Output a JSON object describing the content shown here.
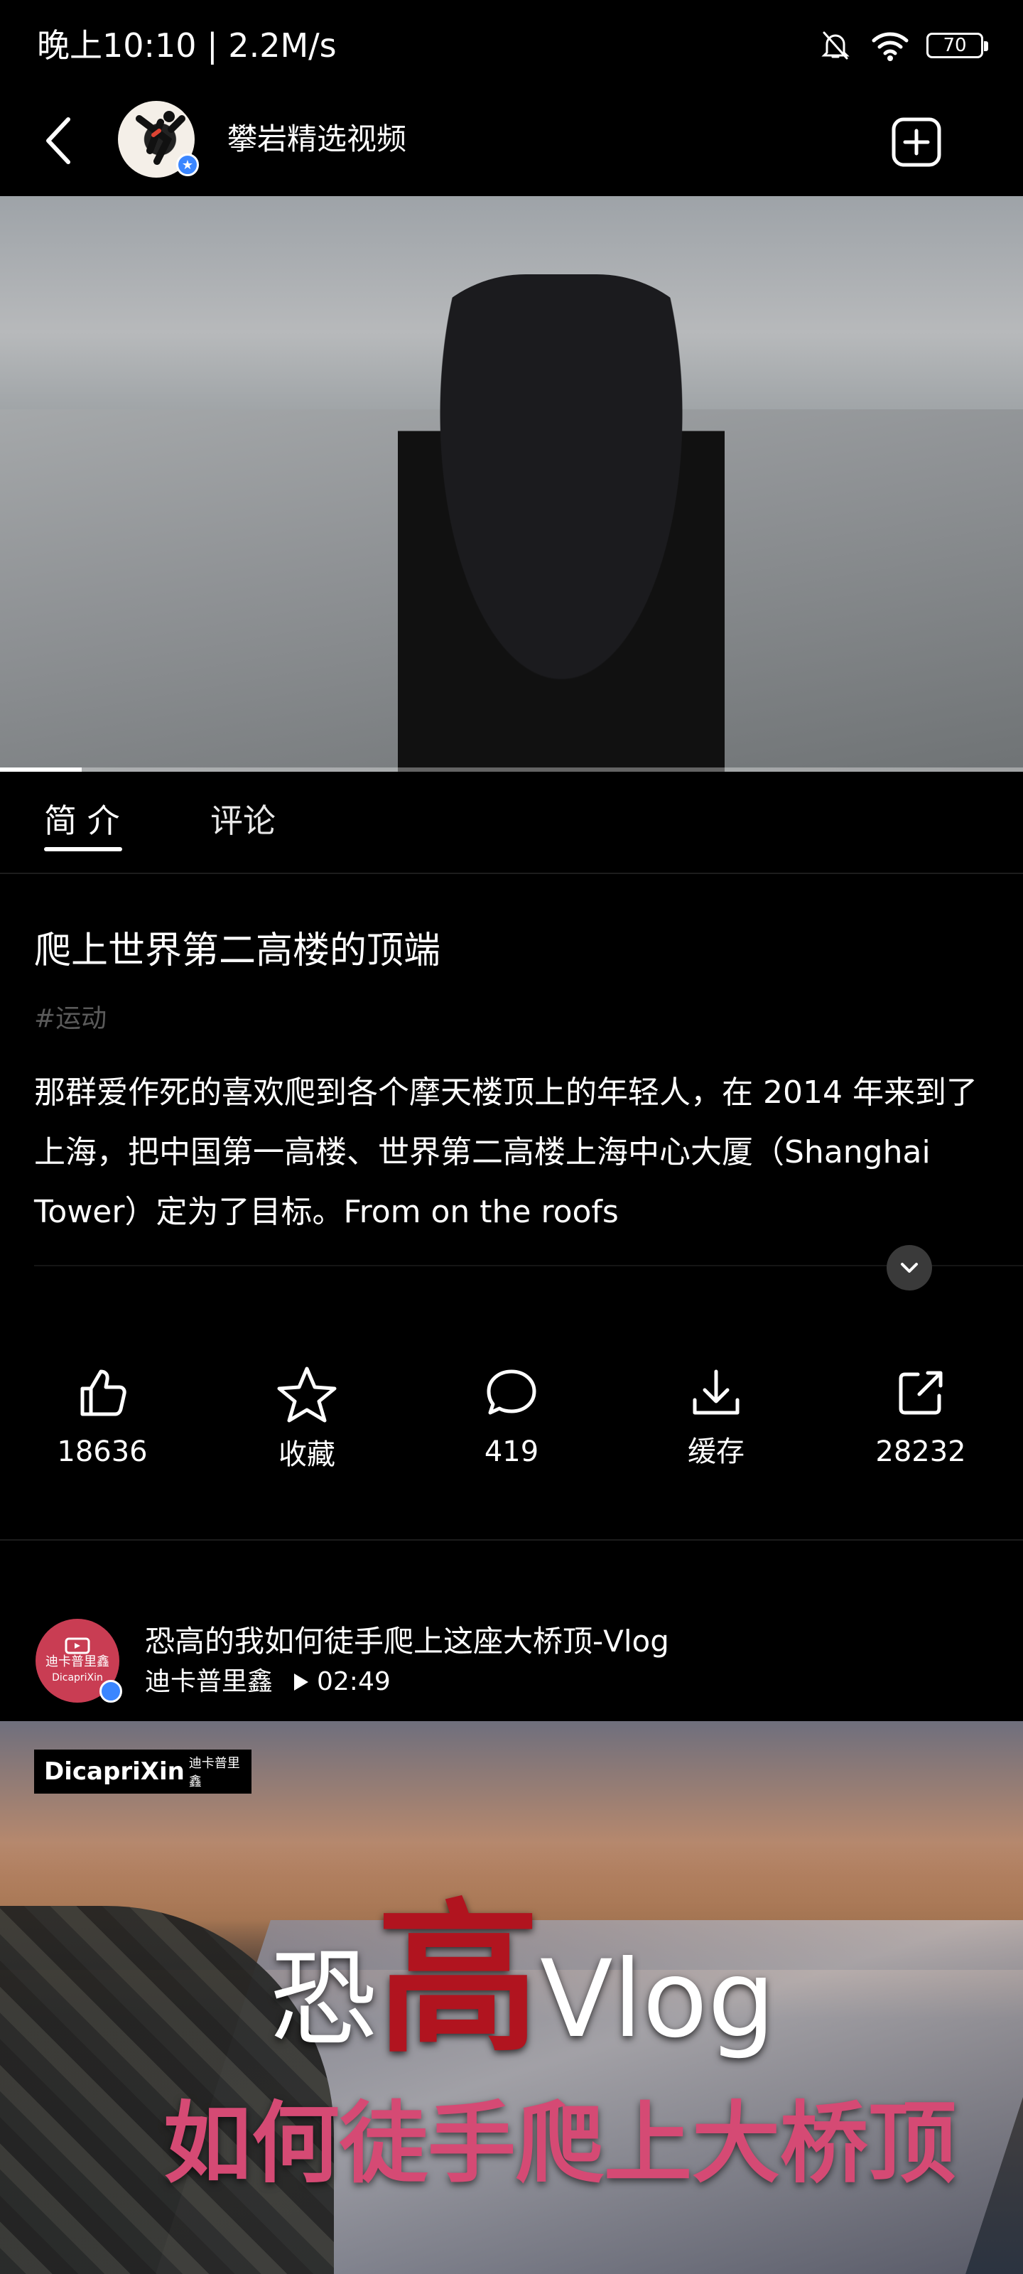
{
  "status_bar": {
    "time_speed": "晚上10:10 | 2.2M/s",
    "battery": "70"
  },
  "header": {
    "channel_name": "攀岩精选视频"
  },
  "video": {
    "progress_percent": 8
  },
  "tabs": [
    {
      "label": "简 介"
    },
    {
      "label": "评论"
    }
  ],
  "content": {
    "title": "爬上世界第二高楼的顶端",
    "tag": "#运动",
    "description": "那群爱作死的喜欢爬到各个摩天楼顶上的年轻人，在 2014 年来到了上海，把中国第一高楼、世界第二高楼上海中心大厦（Shanghai Tower）定为了目标。From on the roofs"
  },
  "actions": [
    {
      "label": "18636",
      "icon": "thumbs-up-icon"
    },
    {
      "label": "收藏",
      "icon": "star-icon"
    },
    {
      "label": "419",
      "icon": "comment-icon"
    },
    {
      "label": "缓存",
      "icon": "download-icon"
    },
    {
      "label": "28232",
      "icon": "share-icon"
    }
  ],
  "recommended": {
    "avatar_text": "迪卡普里鑫",
    "avatar_sub": "DicapriXin",
    "title": "恐高的我如何徒手爬上这座大桥顶-Vlog",
    "author": "迪卡普里鑫",
    "duration": "02:49",
    "thumb_logo": "DicapriXin",
    "thumb_logo_small": "迪卡普里鑫",
    "thumb_heading_left": "恐",
    "thumb_heading_big": "高",
    "thumb_heading_right": "Vlog",
    "thumb_subheading": "如何徒手爬上大桥顶"
  }
}
